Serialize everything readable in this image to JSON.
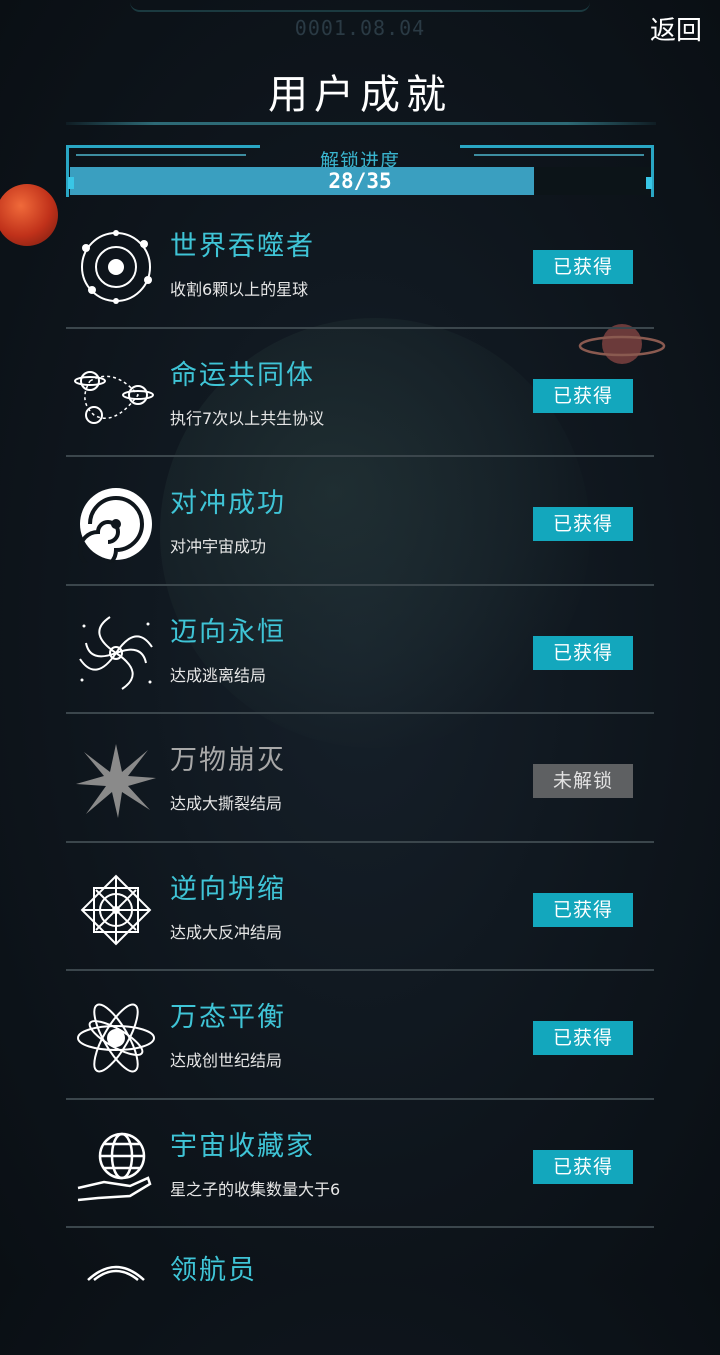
{
  "header": {
    "date": "0001.08.04",
    "back_label": "返回",
    "title": "用户成就"
  },
  "progress": {
    "label": "解锁进度",
    "text": "28/35",
    "value": 28,
    "total": 35
  },
  "achievements": [
    {
      "name": "世界吞噬者",
      "desc": "收割6颗以上的星球",
      "status": "已获得",
      "unlocked": true,
      "icon": "orbit-network-icon"
    },
    {
      "name": "命运共同体",
      "desc": "执行7次以上共生协议",
      "status": "已获得",
      "unlocked": true,
      "icon": "linked-planets-icon"
    },
    {
      "name": "对冲成功",
      "desc": "对冲宇宙成功",
      "status": "已获得",
      "unlocked": true,
      "icon": "swirl-vortex-icon"
    },
    {
      "name": "迈向永恒",
      "desc": "达成逃离结局",
      "status": "已获得",
      "unlocked": true,
      "icon": "spiral-galaxy-icon"
    },
    {
      "name": "万物崩灭",
      "desc": "达成大撕裂结局",
      "status": "未解锁",
      "unlocked": false,
      "icon": "starburst-icon"
    },
    {
      "name": "逆向坍缩",
      "desc": "达成大反冲结局",
      "status": "已获得",
      "unlocked": true,
      "icon": "mandala-icon"
    },
    {
      "name": "万态平衡",
      "desc": "达成创世纪结局",
      "status": "已获得",
      "unlocked": true,
      "icon": "atom-orbit-icon"
    },
    {
      "name": "宇宙收藏家",
      "desc": "星之子的收集数量大于6",
      "status": "已获得",
      "unlocked": true,
      "icon": "hand-globe-icon"
    },
    {
      "name": "领航员",
      "icon": "navigator-icon"
    }
  ],
  "colors": {
    "accent": "#13a7bd",
    "title_cyan": "#3fc4d6",
    "locked": "#5e6062"
  }
}
